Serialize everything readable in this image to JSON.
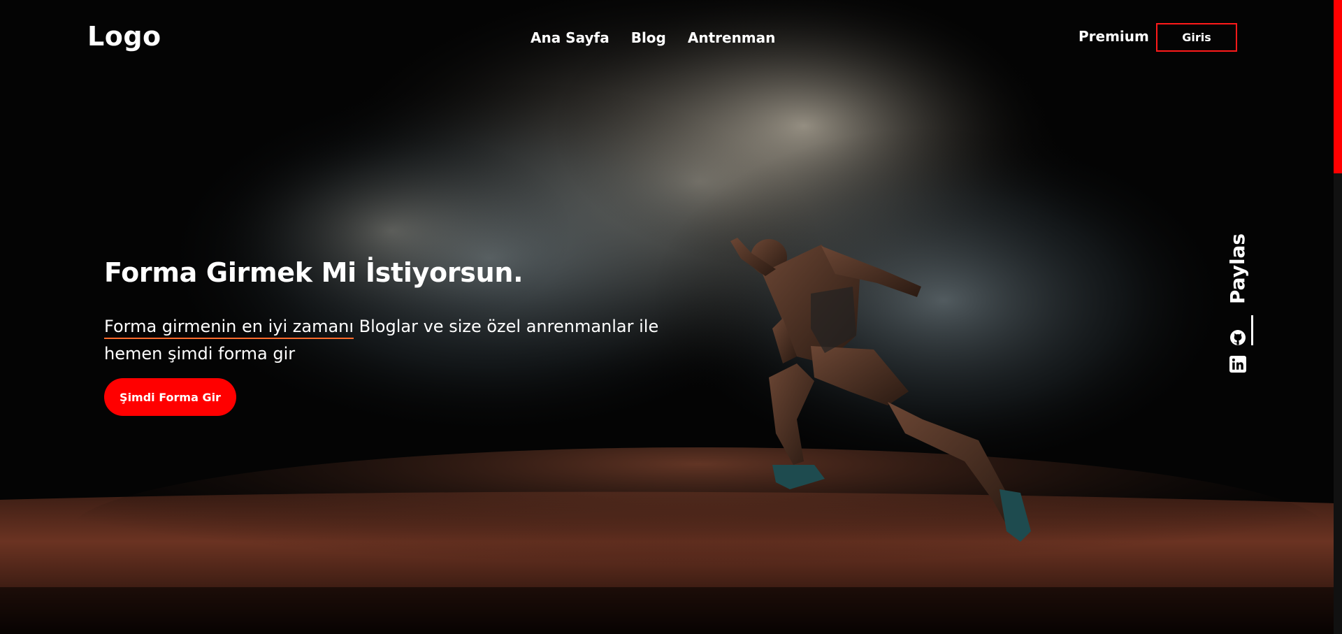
{
  "header": {
    "logo": "Logo",
    "nav": [
      "Ana Sayfa",
      "Blog",
      "Antrenman"
    ],
    "premium": "Premium",
    "login": "Giris"
  },
  "hero": {
    "title": "Forma Girmek Mi İstiyorsun.",
    "desc_highlight": "Forma girmenin en iyi zamanı",
    "desc_rest": " Bloglar ve size özel anrenmanlar ile hemen şimdi forma gir",
    "cta": "Şimdi Forma Gir"
  },
  "share": {
    "label": "Paylas",
    "icons": [
      "github-icon",
      "linkedin-icon"
    ]
  },
  "colors": {
    "accent": "#ff0000",
    "underline": "#ff6b2c",
    "background": "#050505",
    "track": "#5a2a1c"
  }
}
